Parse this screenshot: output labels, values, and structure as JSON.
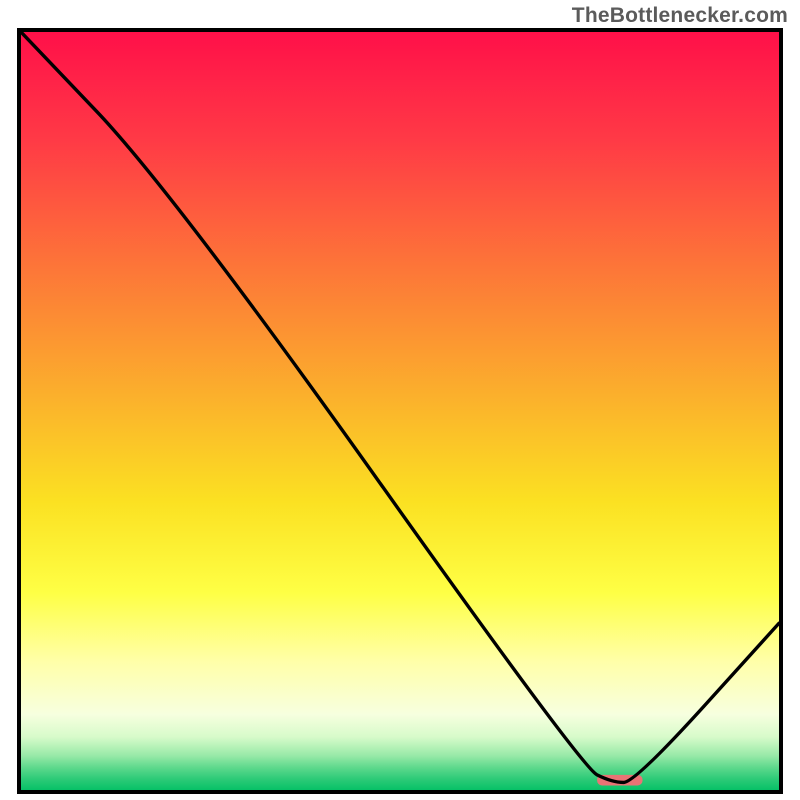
{
  "watermark": "TheBottlenecker.com",
  "chart_data": {
    "type": "line",
    "title": "",
    "xlabel": "",
    "ylabel": "",
    "xlim": [
      0,
      100
    ],
    "ylim": [
      0,
      100
    ],
    "series": [
      {
        "name": "bottleneck-curve",
        "color": "#000000",
        "x": [
          0,
          20,
          74,
          78,
          81,
          100
        ],
        "y": [
          100,
          79,
          3,
          1,
          1,
          22
        ]
      }
    ],
    "marker": {
      "name": "target-bar",
      "color": "#e97375",
      "x_start": 76,
      "x_end": 82,
      "y": 1.3,
      "height_pct": 1.4
    },
    "background": {
      "type": "vertical-gradient",
      "stops": [
        {
          "pct": 0,
          "color": "#ff1049"
        },
        {
          "pct": 14,
          "color": "#ff3946"
        },
        {
          "pct": 30,
          "color": "#fd7239"
        },
        {
          "pct": 48,
          "color": "#fbb02c"
        },
        {
          "pct": 62,
          "color": "#fbe122"
        },
        {
          "pct": 74,
          "color": "#feff45"
        },
        {
          "pct": 83,
          "color": "#ffffa8"
        },
        {
          "pct": 90,
          "color": "#f7ffdf"
        },
        {
          "pct": 93,
          "color": "#d7fbca"
        },
        {
          "pct": 95.5,
          "color": "#97e9a7"
        },
        {
          "pct": 97,
          "color": "#5fd98d"
        },
        {
          "pct": 98.5,
          "color": "#2ecb78"
        },
        {
          "pct": 100,
          "color": "#07c167"
        }
      ]
    }
  }
}
